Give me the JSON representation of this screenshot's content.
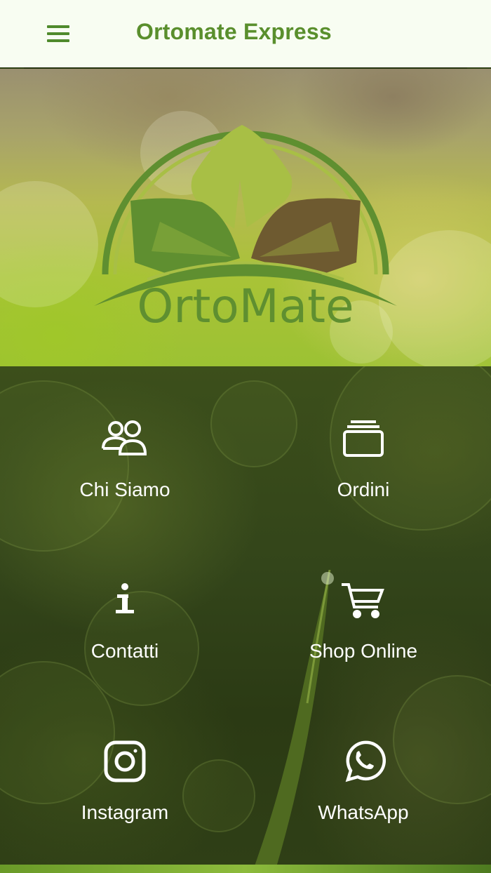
{
  "header": {
    "title": "Ortomate Express",
    "menu_icon": "hamburger-menu-icon",
    "accent_color": "#5a8f2d"
  },
  "hero": {
    "logo_text": "OrtoMate",
    "logo_colors": [
      "#5f8f30",
      "#a8bf45",
      "#6e5a30"
    ]
  },
  "menu": {
    "items": [
      {
        "label": "Chi Siamo",
        "icon": "people-icon"
      },
      {
        "label": "Ordini",
        "icon": "stack-icon"
      },
      {
        "label": "Contatti",
        "icon": "info-icon"
      },
      {
        "label": "Shop Online",
        "icon": "cart-icon"
      },
      {
        "label": "Instagram",
        "icon": "instagram-icon"
      },
      {
        "label": "WhatsApp",
        "icon": "whatsapp-icon"
      }
    ]
  }
}
